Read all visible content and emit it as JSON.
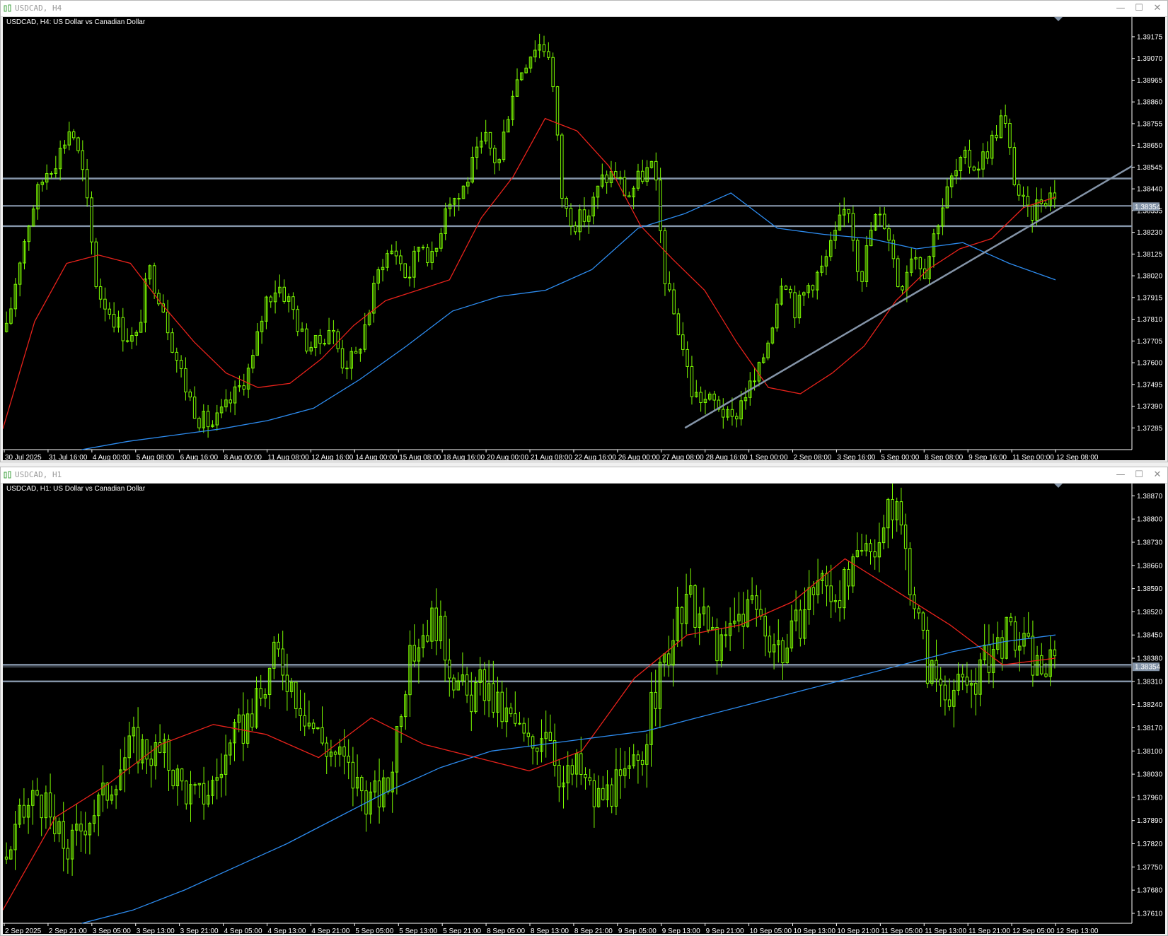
{
  "colors": {
    "background": "#000000",
    "candle": "#7cfc00",
    "ma_fast": "#e8221b",
    "ma_slow": "#2d8cf0",
    "hline": "#8494a8",
    "trendline": "#8494a8",
    "axis_text": "#ffffff"
  },
  "windows": [
    {
      "title": "USDCAD, H4",
      "label": "USDCAD, H4:  US Dollar vs Canadian Dollar",
      "buttons": {
        "minimize": "—",
        "maximize": "☐",
        "close": "✕"
      },
      "chart_data": {
        "type": "candlestick",
        "symbol": "USDCAD",
        "timeframe": "H4",
        "ylim": [
          1.3718,
          1.3925
        ],
        "yticks": [
          "1.39175",
          "1.39070",
          "1.38965",
          "1.38860",
          "1.38755",
          "1.38650",
          "1.38545",
          "1.38440",
          "1.38335",
          "1.38230",
          "1.38125",
          "1.38020",
          "1.37915",
          "1.37810",
          "1.37705",
          "1.37600",
          "1.37495",
          "1.37390",
          "1.37285"
        ],
        "xticks": [
          "30 Jul 2025",
          "31 Jul 16:00",
          "4 Aug 00:00",
          "5 Aug 08:00",
          "6 Aug 16:00",
          "8 Aug 00:00",
          "11 Aug 08:00",
          "12 Aug 16:00",
          "14 Aug 00:00",
          "15 Aug 08:00",
          "18 Aug 16:00",
          "20 Aug 00:00",
          "21 Aug 08:00",
          "22 Aug 16:00",
          "26 Aug 00:00",
          "27 Aug 08:00",
          "28 Aug 16:00",
          "1 Sep 00:00",
          "2 Sep 08:00",
          "3 Sep 16:00",
          "5 Sep 00:00",
          "8 Sep 08:00",
          "9 Sep 16:00",
          "11 Sep 00:00",
          "12 Sep 08:00"
        ],
        "current_price": "1.38354",
        "close_path": [
          1.3775,
          1.381,
          1.3835,
          1.3852,
          1.386,
          1.3875,
          1.3848,
          1.3795,
          1.3785,
          1.3775,
          1.377,
          1.3805,
          1.379,
          1.3765,
          1.3745,
          1.3732,
          1.373,
          1.3738,
          1.3748,
          1.376,
          1.379,
          1.3798,
          1.3788,
          1.377,
          1.3768,
          1.3778,
          1.376,
          1.3762,
          1.3785,
          1.381,
          1.3815,
          1.38,
          1.382,
          1.3808,
          1.384,
          1.384,
          1.3855,
          1.3868,
          1.3855,
          1.389,
          1.3905,
          1.3915,
          1.391,
          1.3835,
          1.3828,
          1.3832,
          1.3848,
          1.3852,
          1.384,
          1.385,
          1.3855,
          1.3795,
          1.3775,
          1.3745,
          1.3742,
          1.374,
          1.373,
          1.3745,
          1.3752,
          1.3775,
          1.3805,
          1.3785,
          1.3798,
          1.3805,
          1.382,
          1.3838,
          1.38,
          1.383,
          1.3828,
          1.3795,
          1.3815,
          1.3805,
          1.383,
          1.3848,
          1.3858,
          1.3855,
          1.3865,
          1.388,
          1.3845,
          1.383,
          1.384,
          1.3842
        ],
        "ma_fast": [
          1.3728,
          1.378,
          1.3808,
          1.3812,
          1.3808,
          1.3788,
          1.377,
          1.3755,
          1.3748,
          1.375,
          1.3762,
          1.3778,
          1.379,
          1.3795,
          1.38,
          1.383,
          1.385,
          1.3878,
          1.3872,
          1.3855,
          1.3826,
          1.381,
          1.3795,
          1.377,
          1.3748,
          1.3745,
          1.3755,
          1.3768,
          1.379,
          1.3805,
          1.3815,
          1.382,
          1.3835,
          1.384
        ],
        "ma_slow": [
          1.3718,
          1.3722,
          1.3725,
          1.3728,
          1.3732,
          1.3738,
          1.3752,
          1.3768,
          1.3785,
          1.3792,
          1.3795,
          1.3805,
          1.3825,
          1.3832,
          1.3842,
          1.3825,
          1.3822,
          1.382,
          1.3815,
          1.3818,
          1.3808,
          1.38
        ],
        "hlines": [
          1.3849,
          1.3836,
          1.3826
        ],
        "trendline": {
          "from": [
            "28 Aug 16:00",
            1.37285
          ],
          "to": [
            "12 Sep 13:00",
            1.385
          ]
        }
      }
    },
    {
      "title": "USDCAD, H1",
      "label": "USDCAD, H1:  US Dollar vs Canadian Dollar",
      "buttons": {
        "minimize": "—",
        "maximize": "☐",
        "close": "✕"
      },
      "chart_data": {
        "type": "candlestick",
        "symbol": "USDCAD",
        "timeframe": "H1",
        "ylim": [
          1.3758,
          1.3889
        ],
        "yticks": [
          "1.38870",
          "1.38800",
          "1.38730",
          "1.38660",
          "1.38590",
          "1.38520",
          "1.38450",
          "1.38380",
          "1.38310",
          "1.38240",
          "1.38170",
          "1.38100",
          "1.38030",
          "1.37960",
          "1.37890",
          "1.37820",
          "1.37750",
          "1.37680",
          "1.37610"
        ],
        "xticks": [
          "2 Sep 2025",
          "2 Sep 21:00",
          "3 Sep 05:00",
          "3 Sep 13:00",
          "3 Sep 21:00",
          "4 Sep 05:00",
          "4 Sep 13:00",
          "4 Sep 21:00",
          "5 Sep 05:00",
          "5 Sep 13:00",
          "5 Sep 21:00",
          "8 Sep 05:00",
          "8 Sep 13:00",
          "8 Sep 21:00",
          "9 Sep 05:00",
          "9 Sep 13:00",
          "9 Sep 21:00",
          "10 Sep 05:00",
          "10 Sep 13:00",
          "10 Sep 21:00",
          "11 Sep 05:00",
          "11 Sep 13:00",
          "11 Sep 21:00",
          "12 Sep 05:00",
          "12 Sep 13:00"
        ],
        "current_price": "1.38354",
        "close_path": [
          1.3778,
          1.379,
          1.3798,
          1.3785,
          1.378,
          1.379,
          1.3795,
          1.3805,
          1.3812,
          1.381,
          1.3808,
          1.38,
          1.3795,
          1.38,
          1.381,
          1.3818,
          1.3825,
          1.384,
          1.383,
          1.382,
          1.3812,
          1.3808,
          1.38,
          1.3795,
          1.3798,
          1.383,
          1.3845,
          1.385,
          1.3835,
          1.3825,
          1.383,
          1.3822,
          1.3818,
          1.381,
          1.382,
          1.38,
          1.3805,
          1.3795,
          1.3798,
          1.38,
          1.381,
          1.383,
          1.3845,
          1.3855,
          1.3848,
          1.384,
          1.385,
          1.3855,
          1.3845,
          1.384,
          1.385,
          1.3862,
          1.3858,
          1.386,
          1.387,
          1.3875,
          1.3885,
          1.386,
          1.3835,
          1.383,
          1.3828,
          1.3832,
          1.384,
          1.3845,
          1.3842,
          1.3835,
          1.3836
        ],
        "ma_fast": [
          1.3762,
          1.379,
          1.38,
          1.3812,
          1.3818,
          1.3815,
          1.3808,
          1.382,
          1.3812,
          1.3808,
          1.3804,
          1.381,
          1.3832,
          1.3845,
          1.3848,
          1.3855,
          1.3868,
          1.3858,
          1.3848,
          1.3836,
          1.3838
        ],
        "ma_slow": [
          1.3758,
          1.3762,
          1.3768,
          1.3775,
          1.3782,
          1.379,
          1.3798,
          1.3805,
          1.381,
          1.3812,
          1.3814,
          1.3816,
          1.382,
          1.3824,
          1.3828,
          1.3832,
          1.3836,
          1.384,
          1.3843,
          1.3845
        ],
        "hlines": [
          1.3836,
          1.3831
        ]
      }
    }
  ]
}
